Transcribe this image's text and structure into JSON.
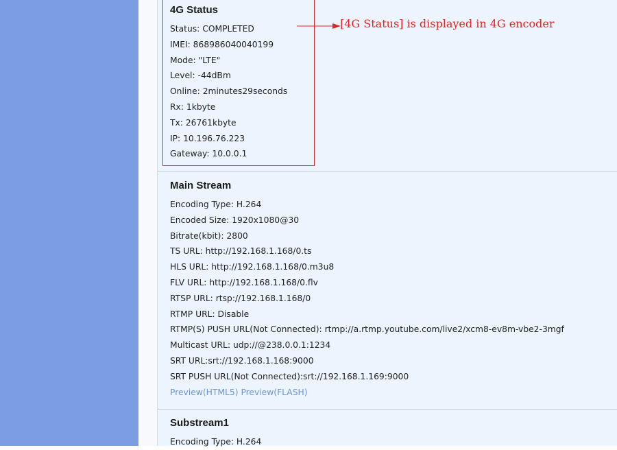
{
  "status_4g": {
    "title": "4G Status",
    "rows": [
      "Status: COMPLETED",
      "IMEI: 868986040040199",
      "Mode: \"LTE\"",
      "Level: -44dBm",
      "Online: 2minutes29seconds",
      "Rx: 1kbyte",
      "Tx: 26761kbyte",
      "IP: 10.196.76.223",
      "Gateway: 10.0.0.1"
    ]
  },
  "annotation": {
    "text": "[4G Status] is displayed in 4G encoder",
    "color": "#e8201b"
  },
  "main_stream": {
    "title": "Main Stream",
    "rows": [
      "Encoding Type: H.264",
      "Encoded Size: 1920x1080@30",
      "Bitrate(kbit): 2800",
      "TS URL: http://192.168.1.168/0.ts",
      "HLS URL: http://192.168.1.168/0.m3u8",
      "FLV URL: http://192.168.1.168/0.flv",
      "RTSP URL: rtsp://192.168.1.168/0",
      "RTMP URL: Disable",
      "RTMP(S) PUSH URL(Not Connected): rtmp://a.rtmp.youtube.com/live2/xcm8-ev8m-vbe2-3mgf",
      "Multicast URL: udp://@238.0.0.1:1234",
      "SRT URL:srt://192.168.1.168:9000",
      "SRT PUSH URL(Not Connected):srt://192.168.1.169:9000"
    ],
    "preview_html5": "Preview(HTML5)",
    "preview_flash": "Preview(FLASH)"
  },
  "substream1": {
    "title": "Substream1",
    "rows": [
      "Encoding Type: H.264"
    ]
  },
  "colors": {
    "sidebar": "#7b9ee2",
    "content_bg": "#ecf4fd",
    "link": "#6b94d6",
    "highlight_box": "#d62a2a"
  }
}
